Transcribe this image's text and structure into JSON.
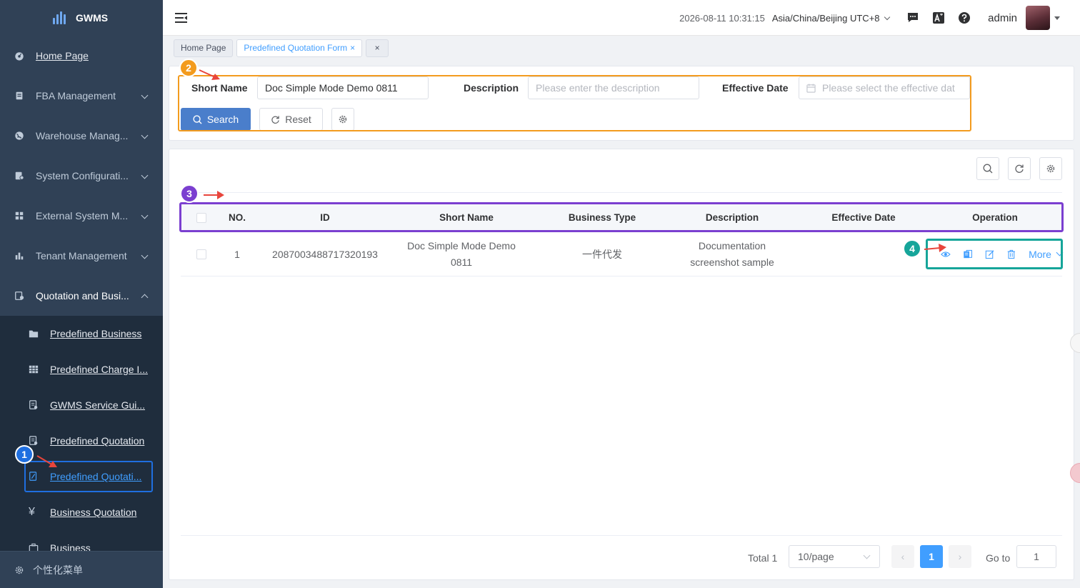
{
  "app": {
    "name": "GWMS",
    "brand_color": "#304156",
    "accent": "#409eff"
  },
  "sidebar": {
    "items": [
      {
        "label": "Home Page",
        "icon": "dashboard-icon"
      },
      {
        "label": "FBA Management",
        "icon": "fba-icon"
      },
      {
        "label": "Warehouse Manag...",
        "icon": "globe-icon"
      },
      {
        "label": "System Configurati...",
        "icon": "config-icon"
      },
      {
        "label": "External System M...",
        "icon": "grid-icon"
      },
      {
        "label": "Tenant Management",
        "icon": "bar-chart-icon"
      },
      {
        "label": "Quotation and Busi...",
        "icon": "quotation-icon"
      }
    ],
    "submenu": [
      {
        "label": "Predefined Business",
        "icon": "folder-icon"
      },
      {
        "label": "Predefined Charge I...",
        "icon": "table-icon"
      },
      {
        "label": "GWMS Service Gui...",
        "icon": "document-icon"
      },
      {
        "label": "Predefined Quotation",
        "icon": "document-icon"
      },
      {
        "label": "Predefined Quotati...",
        "icon": "edit-doc-icon"
      },
      {
        "label": "Business Quotation",
        "icon": "yen-icon"
      },
      {
        "label": "Business",
        "icon": "briefcase-icon"
      }
    ],
    "footer_label": "个性化菜单"
  },
  "header": {
    "datetime": "2026-08-11 10:31:15",
    "timezone": "Asia/China/Beijing UTC+8",
    "user": "admin"
  },
  "tags": [
    {
      "label": "Home Page"
    },
    {
      "label": "Predefined Quotation Form",
      "close": "×"
    },
    {
      "close": "×"
    }
  ],
  "search": {
    "short_name_label": "Short Name",
    "short_name_value": "Doc Simple Mode Demo 0811",
    "description_label": "Description",
    "description_placeholder": "Please enter the description",
    "effective_date_label": "Effective Date",
    "effective_date_placeholder": "Please select the effective dat",
    "search_button": "Search",
    "reset_button": "Reset"
  },
  "table": {
    "columns": [
      "NO.",
      "ID",
      "Short Name",
      "Business Type",
      "Description",
      "Effective Date",
      "Operation"
    ],
    "rows": [
      {
        "no": "1",
        "id": "2087003488717320193",
        "short_name": "Doc Simple Mode Demo 0811",
        "business_type": "一件代发",
        "description": "Documentation screenshot sample",
        "effective_date": "",
        "more_label": "More"
      }
    ]
  },
  "pagination": {
    "total": "Total 1",
    "page_size": "10/page",
    "current_page": "1",
    "prev": "‹",
    "next": "›",
    "goto_label": "Go to",
    "goto_value": "1"
  },
  "annotations": [
    {
      "number": "1",
      "color": "#1f6fe0"
    },
    {
      "number": "2",
      "color": "#f39b1e"
    },
    {
      "number": "3",
      "color": "#7b3fd0"
    },
    {
      "number": "4",
      "color": "#16a59a"
    }
  ]
}
